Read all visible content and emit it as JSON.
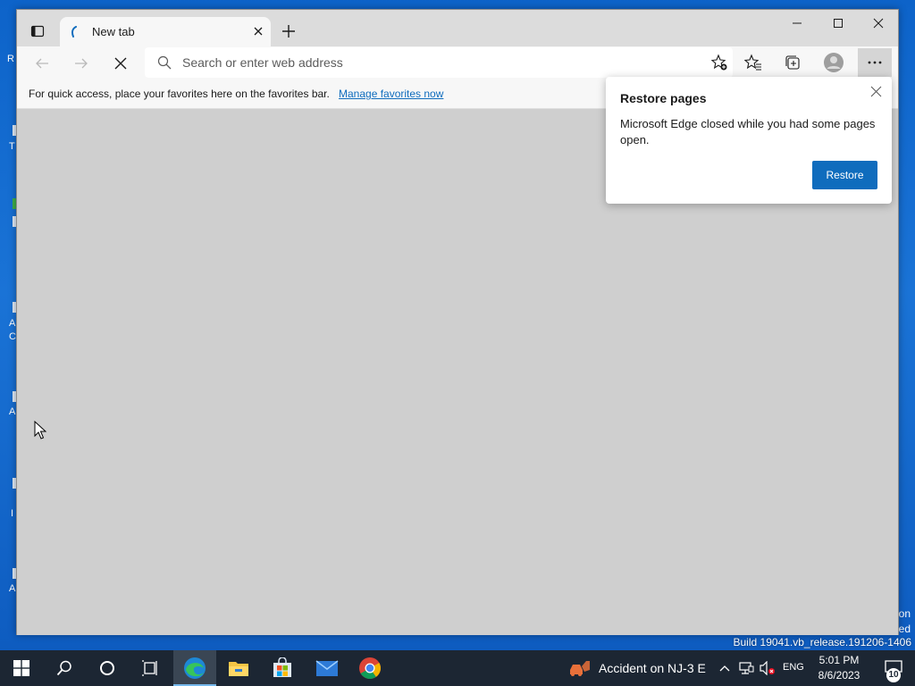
{
  "desktop": {
    "fragments": [
      "R",
      "T",
      "A",
      "C",
      "A",
      "I",
      "A"
    ],
    "build_text": "Build 19041.vb_release.191206-1406",
    "watermark_lines": [
      "on",
      "ed"
    ]
  },
  "browser": {
    "tab": {
      "title": "New tab",
      "close_icon": "close-icon",
      "loading_icon": "loading-spinner-icon"
    },
    "window_controls": {
      "minimize": "minimize-icon",
      "maximize": "maximize-icon",
      "close": "close-icon"
    },
    "address_bar": {
      "placeholder": "Search or enter web address",
      "value": ""
    },
    "favorites_bar": {
      "message": "For quick access, place your favorites here on the favorites bar.",
      "link_text": "Manage favorites now"
    },
    "restore_popup": {
      "title": "Restore pages",
      "message": "Microsoft Edge closed while you had some pages open.",
      "button_label": "Restore"
    },
    "colors": {
      "accent": "#0f6cbd",
      "content_bg": "#cfcfcf",
      "chrome_bg": "#f7f7f7"
    }
  },
  "taskbar": {
    "news": "Accident on NJ-3 E",
    "language": "ENG",
    "time": "5:01 PM",
    "date": "8/6/2023",
    "notification_count": "10",
    "apps": [
      "edge-icon",
      "file-explorer-icon",
      "store-icon",
      "mail-icon",
      "chrome-icon"
    ]
  }
}
